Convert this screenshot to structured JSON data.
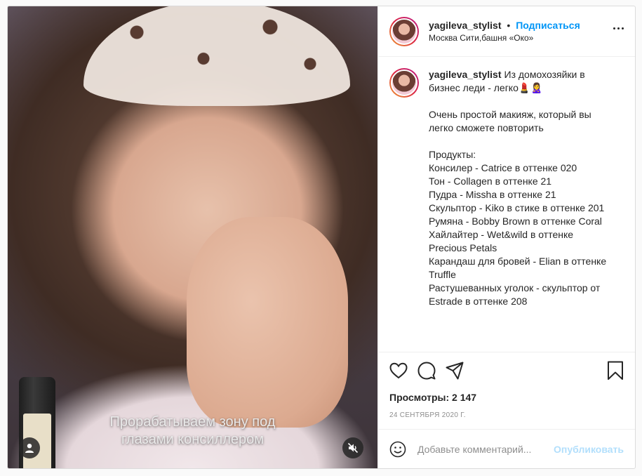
{
  "header": {
    "username": "yagileva_stylist",
    "separator": "•",
    "follow_label": "Подписаться",
    "location": "Москва Сити,башня «Око»"
  },
  "media": {
    "caption_line1": "Прорабатываем зону под",
    "caption_line2": "глазами консиллером"
  },
  "post": {
    "username": "yagileva_stylist",
    "text": "Из домохозяйки в бизнес леди - легко💄🙎‍♀️\n\nОчень простой макияж, который вы легко сможете повторить\n\nПродукты:\nКонсилер - Catrice в оттенке 020\nТон - Collagen в оттенке 21\nПудра - Missha в оттенке 21\nСкульптор - Kiko в стике в оттенке 201\nРумяна - Bobby Brown в оттенке Coral\nХайлайтер - Wet&wild в оттенке Precious Petals\nКарандаш для бровей - Elian в оттенке Truffle\nРастушеванных уголок - скульптор от Estrade в оттенке 208"
  },
  "stats": {
    "views": "Просмотры: 2 147",
    "date": "24 сентября 2020 г."
  },
  "comment_box": {
    "placeholder": "Добавьте комментарий...",
    "publish_label": "Опубликовать"
  },
  "colors": {
    "accent": "#0095f6",
    "publish_disabled": "#b2dffc",
    "muted": "#8e8e8e",
    "border": "#dbdbdb"
  },
  "icons": [
    "user-icon",
    "mute-icon",
    "more-icon",
    "heart-icon",
    "comment-icon",
    "share-icon",
    "bookmark-icon",
    "emoji-icon"
  ]
}
